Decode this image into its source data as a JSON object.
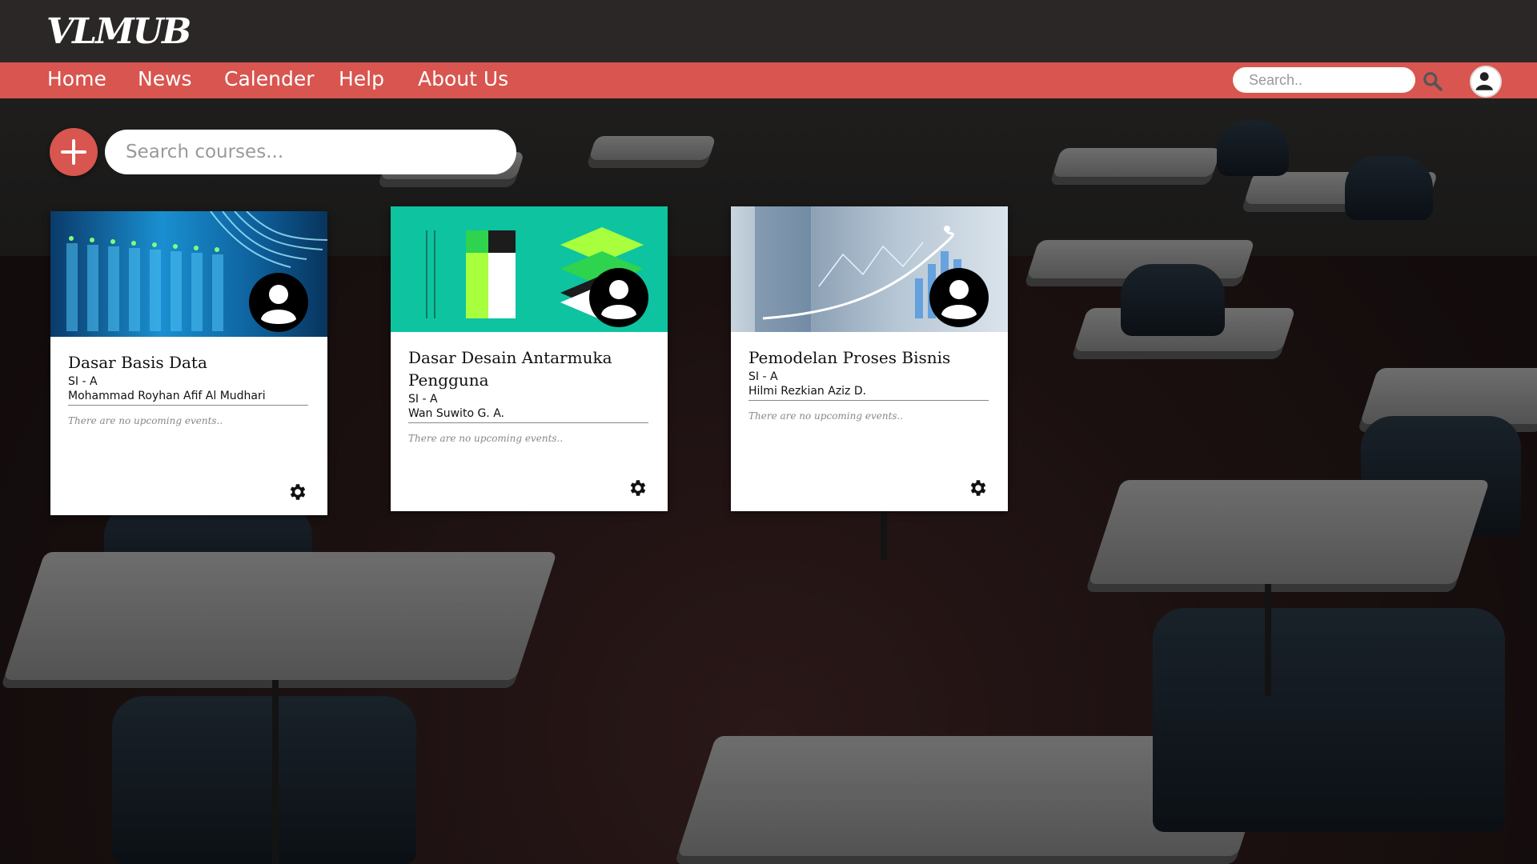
{
  "app": {
    "logo": "VLMUB"
  },
  "nav": {
    "items": [
      {
        "label": "Home"
      },
      {
        "label": "News"
      },
      {
        "label": "Calender"
      },
      {
        "label": "Help"
      },
      {
        "label": "About Us"
      }
    ],
    "search_placeholder": "Search..",
    "search_icon": "search-icon",
    "accent_color": "#d9554f"
  },
  "toolbar": {
    "add_icon": "plus-icon",
    "search_placeholder": "Search courses..."
  },
  "courses": [
    {
      "title": "Dasar Basis Data",
      "class": "SI - A",
      "teacher": "Mohammad Royhan Afif Al Mudhari",
      "events": "There are no upcoming events..",
      "settings_icon": "gear-icon"
    },
    {
      "title": "Dasar Desain Antarmuka Pengguna",
      "class": "SI - A",
      "teacher": "Wan Suwito G. A.",
      "events": "There are no upcoming events..",
      "settings_icon": "gear-icon"
    },
    {
      "title": "Pemodelan Proses Bisnis",
      "class": "SI - A",
      "teacher": "Hilmi Rezkian Aziz D.",
      "events": "There are no upcoming events..",
      "settings_icon": "gear-icon"
    }
  ]
}
